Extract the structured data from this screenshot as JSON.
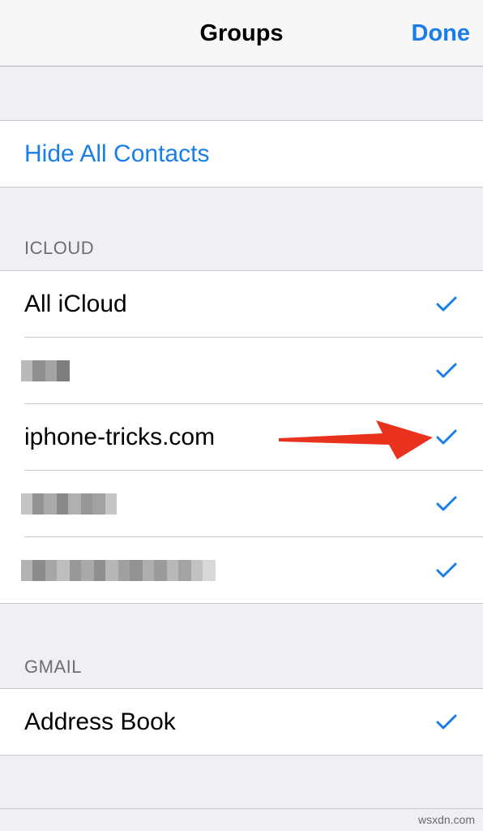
{
  "navbar": {
    "title": "Groups",
    "done_label": "Done"
  },
  "hide_all": {
    "label": "Hide All Contacts"
  },
  "icloud": {
    "header": "ICLOUD",
    "items": [
      {
        "label": "All iCloud",
        "checked": true
      },
      {
        "label": "",
        "checked": true
      },
      {
        "label": "iphone-tricks.com",
        "checked": true
      },
      {
        "label": "",
        "checked": true
      },
      {
        "label": "",
        "checked": true
      }
    ]
  },
  "gmail": {
    "header": "GMAIL",
    "items": [
      {
        "label": "Address Book",
        "checked": true
      }
    ]
  },
  "icons": {
    "check": "checkmark-icon",
    "annotation": "red-arrow-annotation"
  },
  "colors": {
    "accent": "#1a7ee8",
    "group_bg": "#efeff4",
    "annotation": "#e8321e"
  },
  "watermark": "wsxdn.com"
}
